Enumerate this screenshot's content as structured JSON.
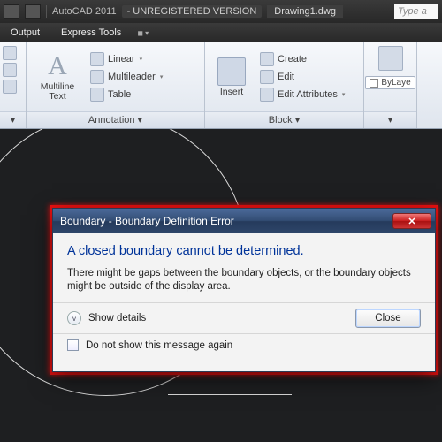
{
  "titlebar": {
    "app": "AutoCAD 2011",
    "badge": "- UNREGISTERED VERSION",
    "doc": "Drawing1.dwg",
    "command_prompt": "Type a"
  },
  "tabs": {
    "output": "Output",
    "express": "Express Tools"
  },
  "ribbon": {
    "annotation": {
      "title": "Annotation ▾",
      "multiline_text": "Multiline\nText",
      "linear": "Linear",
      "multileader": "Multileader",
      "table": "Table"
    },
    "block": {
      "title": "Block ▾",
      "insert": "Insert",
      "create": "Create",
      "edit": "Edit",
      "edit_attributes": "Edit Attributes"
    },
    "layers": {
      "bylayer": "ByLaye"
    }
  },
  "dialog": {
    "title": "Boundary - Boundary Definition Error",
    "heading": "A closed boundary cannot be determined.",
    "message": "There might be gaps between the boundary objects, or the boundary objects might be outside of the display area.",
    "show_details": "Show details",
    "close": "Close",
    "dont_show": "Do not show this message again"
  }
}
